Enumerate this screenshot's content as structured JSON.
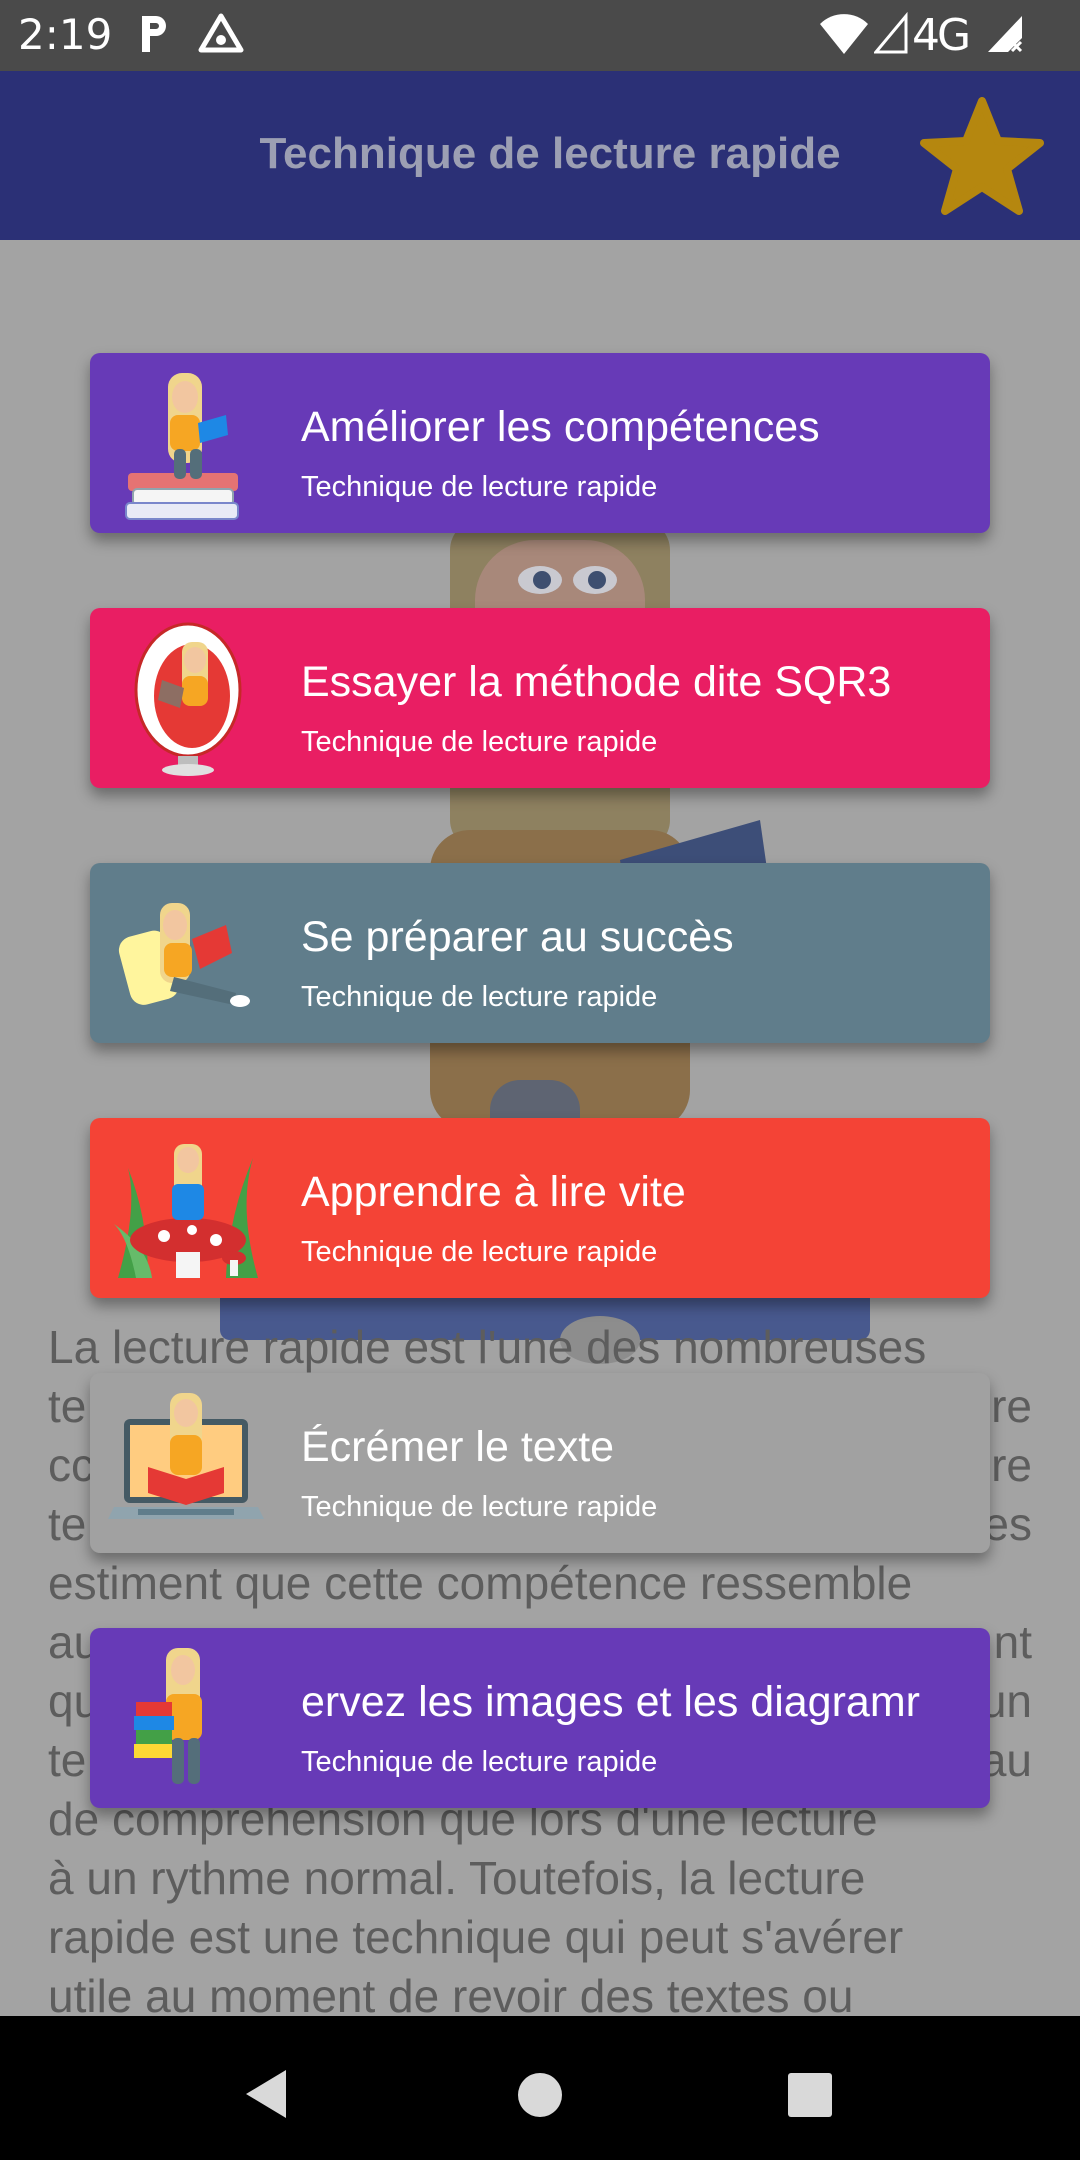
{
  "status": {
    "time": "2:19",
    "network": "4G",
    "icons": [
      "parking-p-icon",
      "triangle-app-icon",
      "wifi-icon",
      "signal-icon",
      "signal-no-sim-icon"
    ]
  },
  "app": {
    "title": "Technique de lecture rapide",
    "favorite_icon": "star-icon",
    "bar_color": "#2b3076",
    "star_color": "#b5870f"
  },
  "cards": [
    {
      "title": "Améliorer les compétences",
      "subtitle": "Technique de lecture rapide",
      "color": "#673ab7",
      "icon": "avatar-on-books-icon"
    },
    {
      "title": "Essayer la méthode dite SQR3",
      "subtitle": "Technique de lecture rapide",
      "color": "#e91e63",
      "icon": "avatar-egg-chair-icon"
    },
    {
      "title": "Se préparer au succès",
      "subtitle": "Technique de lecture rapide",
      "color": "#607d8b",
      "icon": "avatar-reading-pillow-icon"
    },
    {
      "title": "Apprendre à lire vite",
      "subtitle": "Technique de lecture rapide",
      "color": "#f44336",
      "icon": "avatar-mushroom-icon"
    },
    {
      "title": "Écrémer le texte",
      "subtitle": "Technique de lecture rapide",
      "color": "#a1a1a1",
      "icon": "avatar-laptop-icon"
    },
    {
      "title": "ervez les images et les diagramr",
      "subtitle": "Technique de lecture rapide",
      "color": "#673ab7",
      "icon": "avatar-stack-books-icon"
    }
  ],
  "article": {
    "lines": [
      "La lecture rapide est l'une des nombreuses",
      "te",
      "cc",
      "te",
      "estiment que cette compétence ressemble",
      "au",
      "qu",
      "te",
      "de compréhension que lors d'une lecture",
      "à un rythme normal. Toutefois, la lecture",
      "rapide est une technique qui peut s'avérer",
      "utile au moment de revoir des textes ou"
    ],
    "right_fragments": [
      "re",
      "re",
      "es",
      "nt",
      "un",
      "au"
    ]
  },
  "nav": {
    "back_icon": "back-triangle-icon",
    "home_icon": "home-circle-icon",
    "recents_icon": "recents-square-icon"
  }
}
